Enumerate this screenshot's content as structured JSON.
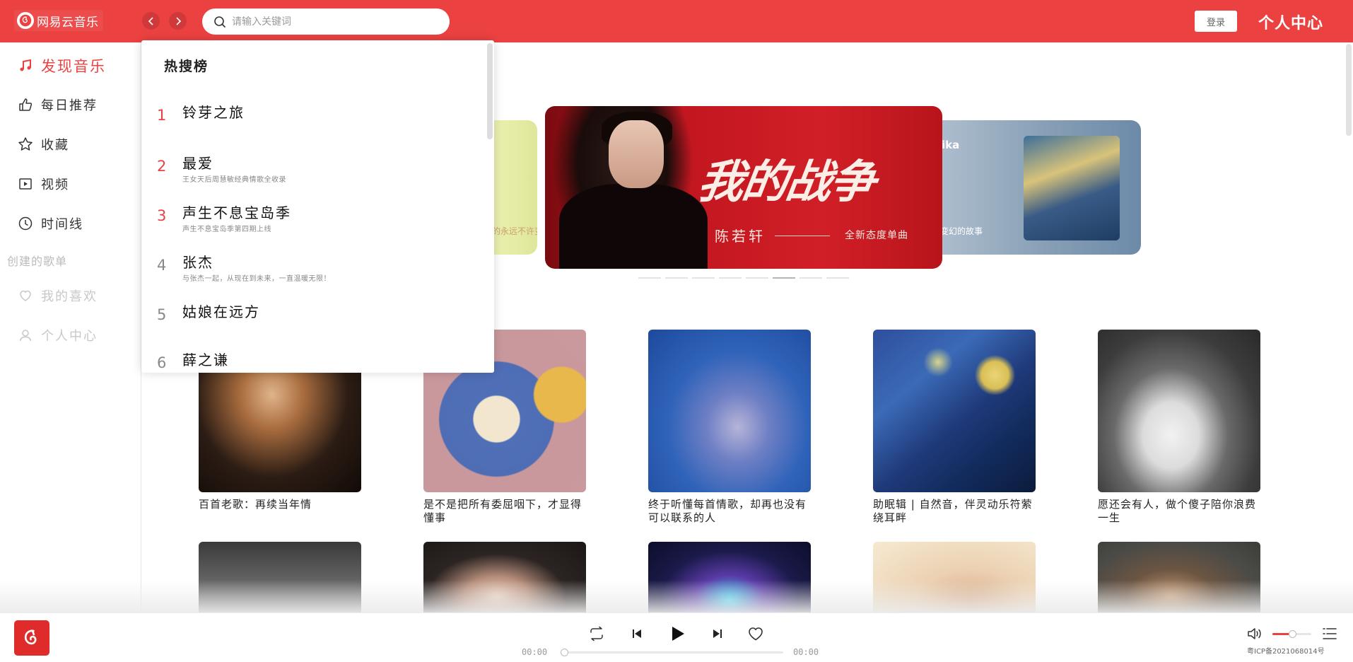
{
  "header": {
    "logo_text": "网易云音乐",
    "search_placeholder": "请输入关键词",
    "login_label": "登录",
    "user_center_label": "个人中心"
  },
  "sidebar": {
    "items": [
      {
        "label": "发现音乐",
        "icon": "music-note-icon",
        "active": true
      },
      {
        "label": "每日推荐",
        "icon": "thumbs-up-icon"
      },
      {
        "label": "收藏",
        "icon": "star-icon"
      },
      {
        "label": "视频",
        "icon": "video-icon"
      },
      {
        "label": "时间线",
        "icon": "clock-icon"
      }
    ],
    "section_title": "创建的歌单",
    "playlists": [
      {
        "label": "我的喜欢",
        "icon": "heart-icon"
      },
      {
        "label": "个人中心",
        "icon": "user-icon"
      }
    ]
  },
  "hot_search": {
    "title": "热搜榜",
    "items": [
      {
        "rank": "1",
        "name": "铃芽之旅",
        "desc": ""
      },
      {
        "rank": "2",
        "name": "最爱",
        "desc": "王女天后周慧敏经典情歌全收录"
      },
      {
        "rank": "3",
        "name": "声生不息宝岛季",
        "desc": "声生不息宝岛季第四期上线"
      },
      {
        "rank": "4",
        "name": "张杰",
        "desc": "与张杰一起，从现在到未来，一直温暖无限！"
      },
      {
        "rank": "5",
        "name": "姑娘在远方",
        "desc": ""
      },
      {
        "rank": "6",
        "name": "薛之谦",
        "desc": ""
      }
    ]
  },
  "banner": {
    "main_title": "我的战争",
    "main_artist": "陈若轩",
    "main_sub": "全新态度单曲",
    "left_partial_text": "的永远不许变",
    "right_partial_title": "ika",
    "right_partial_text": "变幻的故事",
    "active_dot": 5,
    "dot_count": 8
  },
  "playlists": [
    {
      "name": "百首老歌：再续当年情"
    },
    {
      "name": "是不是把所有委屈咽下，才显得懂事"
    },
    {
      "name": "终于听懂每首情歌，却再也没有可以联系的人"
    },
    {
      "name": "助眠辑 | 自然音，伴灵动乐符萦绕耳畔"
    },
    {
      "name": "愿还会有人，做个傻子陪你浪费一生"
    }
  ],
  "player": {
    "current_time": "00:00",
    "total_time": "00:00",
    "progress": 0,
    "volume": 0.5,
    "icp": "粤ICP备2021068014号"
  },
  "colors": {
    "brand": "#ec4141"
  }
}
